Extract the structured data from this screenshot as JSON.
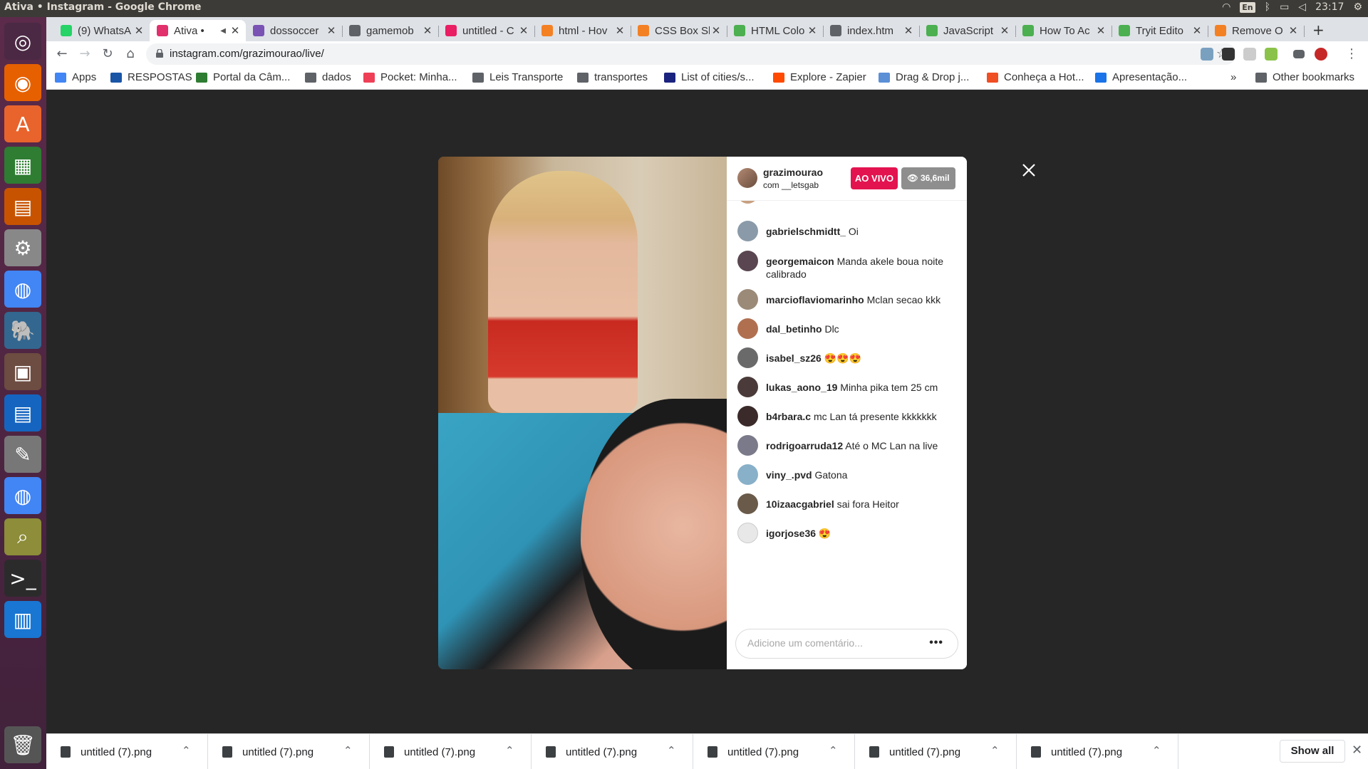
{
  "system": {
    "window_title": "Ativa • Instagram - Google Chrome",
    "language": "En",
    "clock": "23:17"
  },
  "tabs": [
    {
      "label": "(9) WhatsA",
      "icon": "whatsapp-icon",
      "color": "#25d366"
    },
    {
      "label": "Ativa •",
      "icon": "instagram-icon",
      "color": "#e1306c",
      "active": true
    },
    {
      "label": "dossoccer",
      "icon": "h-logo-icon",
      "color": "#7952b3"
    },
    {
      "label": "gamemob",
      "icon": "globe-icon",
      "color": "#5f6368"
    },
    {
      "label": "untitled - C",
      "icon": "colorful-app-icon",
      "color": "#e91e63"
    },
    {
      "label": "html - Hov",
      "icon": "stackoverflow-icon",
      "color": "#f48024"
    },
    {
      "label": "CSS Box Sh",
      "icon": "stackoverflow-icon",
      "color": "#f48024"
    },
    {
      "label": "HTML Colo",
      "icon": "w3schools-icon",
      "color": "#4caf50"
    },
    {
      "label": "index.htm",
      "icon": "globe-icon",
      "color": "#5f6368"
    },
    {
      "label": "JavaScript",
      "icon": "w3schools-icon",
      "color": "#4caf50"
    },
    {
      "label": "How To Ac",
      "icon": "w3schools-icon",
      "color": "#4caf50"
    },
    {
      "label": "Tryit Edito",
      "icon": "w3schools-icon",
      "color": "#4caf50"
    },
    {
      "label": "Remove O",
      "icon": "stackoverflow-icon",
      "color": "#f48024"
    }
  ],
  "omnibox": {
    "url": "instagram.com/grazimourao/live/"
  },
  "bookmarks": [
    {
      "label": "Apps",
      "icon": "apps-grid-icon"
    },
    {
      "label": "RESPOSTAS",
      "icon": "bookmark-s-icon"
    },
    {
      "label": "Portal da Câm...",
      "icon": "portal-icon"
    },
    {
      "label": "dados",
      "icon": "folder-icon"
    },
    {
      "label": "Pocket: Minha...",
      "icon": "pocket-icon"
    },
    {
      "label": "Leis Transporte",
      "icon": "folder-icon"
    },
    {
      "label": "transportes",
      "icon": "folder-icon"
    },
    {
      "label": "List of cities/s...",
      "icon": "wiki-icon"
    },
    {
      "label": "Explore - Zapier",
      "icon": "zapier-icon"
    },
    {
      "label": "Drag & Drop j...",
      "icon": "cloud-icon"
    },
    {
      "label": "Conheça a Hot...",
      "icon": "hotmart-icon"
    },
    {
      "label": "Apresentação...",
      "icon": "presentation-icon"
    },
    {
      "label": "»",
      "icon": "more-icon"
    },
    {
      "label": "Other bookmarks",
      "icon": "folder-icon"
    }
  ],
  "live": {
    "username": "grazimourao",
    "with_text": "com __letsgab",
    "live_badge": "AO VIVO",
    "viewers": "36,6mil",
    "comment_placeholder": "Adicione um comentário...",
    "more_button": "•••"
  },
  "comments": [
    {
      "user": "gabrielschmidtt_",
      "text": "Oi",
      "avatar": "#8a9aa8"
    },
    {
      "user": "georgemaicon",
      "text": "Manda akele boua noite calibrado",
      "avatar": "#5a4650"
    },
    {
      "user": "marcioflaviomarinho",
      "text": "Mclan secao kkk",
      "avatar": "#9b8a78"
    },
    {
      "user": "dal_betinho",
      "text": "Dlc",
      "avatar": "#b07050"
    },
    {
      "user": "isabel_sz26",
      "text": "😍😍😍",
      "avatar": "#6a6a6a"
    },
    {
      "user": "lukas_aono_19",
      "text": "Minha pika tem 25 cm",
      "avatar": "#4a3a3a"
    },
    {
      "user": "b4rbara.c",
      "text": "mc Lan tá presente kkkkkkk",
      "avatar": "#3a2a2a"
    },
    {
      "user": "rodrigoarruda12",
      "text": "Até o MC Lan na live",
      "avatar": "#7a7a8a"
    },
    {
      "user": "viny_.pvd",
      "text": "Gatona",
      "avatar": "#88b0c8"
    },
    {
      "user": "10izaacgabriel",
      "text": "sai fora Heitor",
      "avatar": "#6a5a4a"
    },
    {
      "user": "igorjose36",
      "text": "😍",
      "avatar": "#e8e8e8"
    }
  ],
  "downloads": [
    {
      "label": "untitled (7).png"
    },
    {
      "label": "untitled (7).png"
    },
    {
      "label": "untitled (7).png"
    },
    {
      "label": "untitled (7).png"
    },
    {
      "label": "untitled (7).png"
    },
    {
      "label": "untitled (7).png"
    },
    {
      "label": "untitled (7).png"
    }
  ],
  "shelf": {
    "show_all": "Show all"
  },
  "colors": {
    "live_badge": "#e3134f",
    "viewer_badge": "#8e8e8e",
    "launcher": "#5c2a4a"
  }
}
